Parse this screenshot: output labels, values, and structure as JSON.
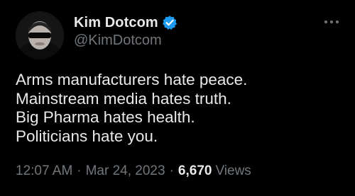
{
  "author": {
    "display_name": "Kim Dotcom",
    "handle": "@KimDotcom",
    "verified": true,
    "verified_color": "#1d9bf0"
  },
  "tweet": {
    "lines": [
      "Arms manufacturers hate peace.",
      "Mainstream media hates truth.",
      "Big Pharma hates health.",
      "Politicians hate you."
    ]
  },
  "meta": {
    "time": "12:07 AM",
    "separator": "·",
    "date": "Mar 24, 2023",
    "views_count": "6,670",
    "views_label": "Views"
  },
  "icons": {
    "more": "more-options-icon",
    "verified": "verified-badge-icon"
  },
  "colors": {
    "background": "#000000",
    "primary_text": "#e7e9ea",
    "secondary_text": "#71767b",
    "accent": "#1d9bf0"
  }
}
